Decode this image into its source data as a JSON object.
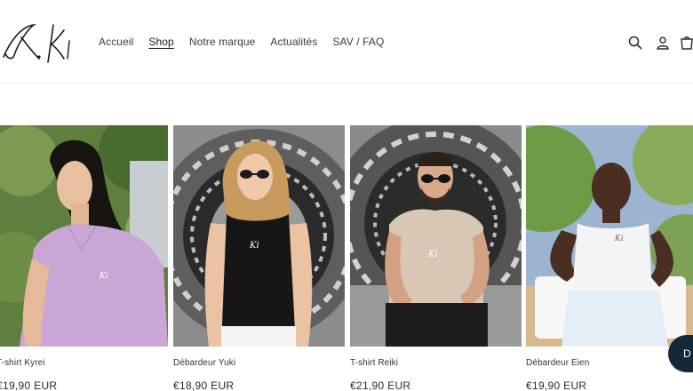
{
  "brand": {
    "logo_alt": "Ki"
  },
  "nav": {
    "items": [
      {
        "label": "Accueil",
        "active": false
      },
      {
        "label": "Shop",
        "active": true
      },
      {
        "label": "Notre marque",
        "active": false
      },
      {
        "label": "Actualités",
        "active": false
      },
      {
        "label": "SAV / FAQ",
        "active": false
      }
    ]
  },
  "header_icons": [
    "search-icon",
    "account-icon",
    "cart-icon"
  ],
  "products": [
    {
      "title": "T-shirt Kyrei",
      "price": "€19,90 EUR",
      "shirt_color": "#c9a6d6",
      "bg": "green"
    },
    {
      "title": "Débardeur Yuki",
      "price": "€18,90 EUR",
      "shirt_color": "#161616",
      "bg": "mandala"
    },
    {
      "title": "T-shirt Reiki",
      "price": "€21,90 EUR",
      "shirt_color": "#d8c7b4",
      "bg": "mandala"
    },
    {
      "title": "Débardeur Eien",
      "price": "€19,90 EUR",
      "shirt_color": "#f4f4f4",
      "bg": "green"
    }
  ],
  "chat": {
    "label": "D"
  }
}
